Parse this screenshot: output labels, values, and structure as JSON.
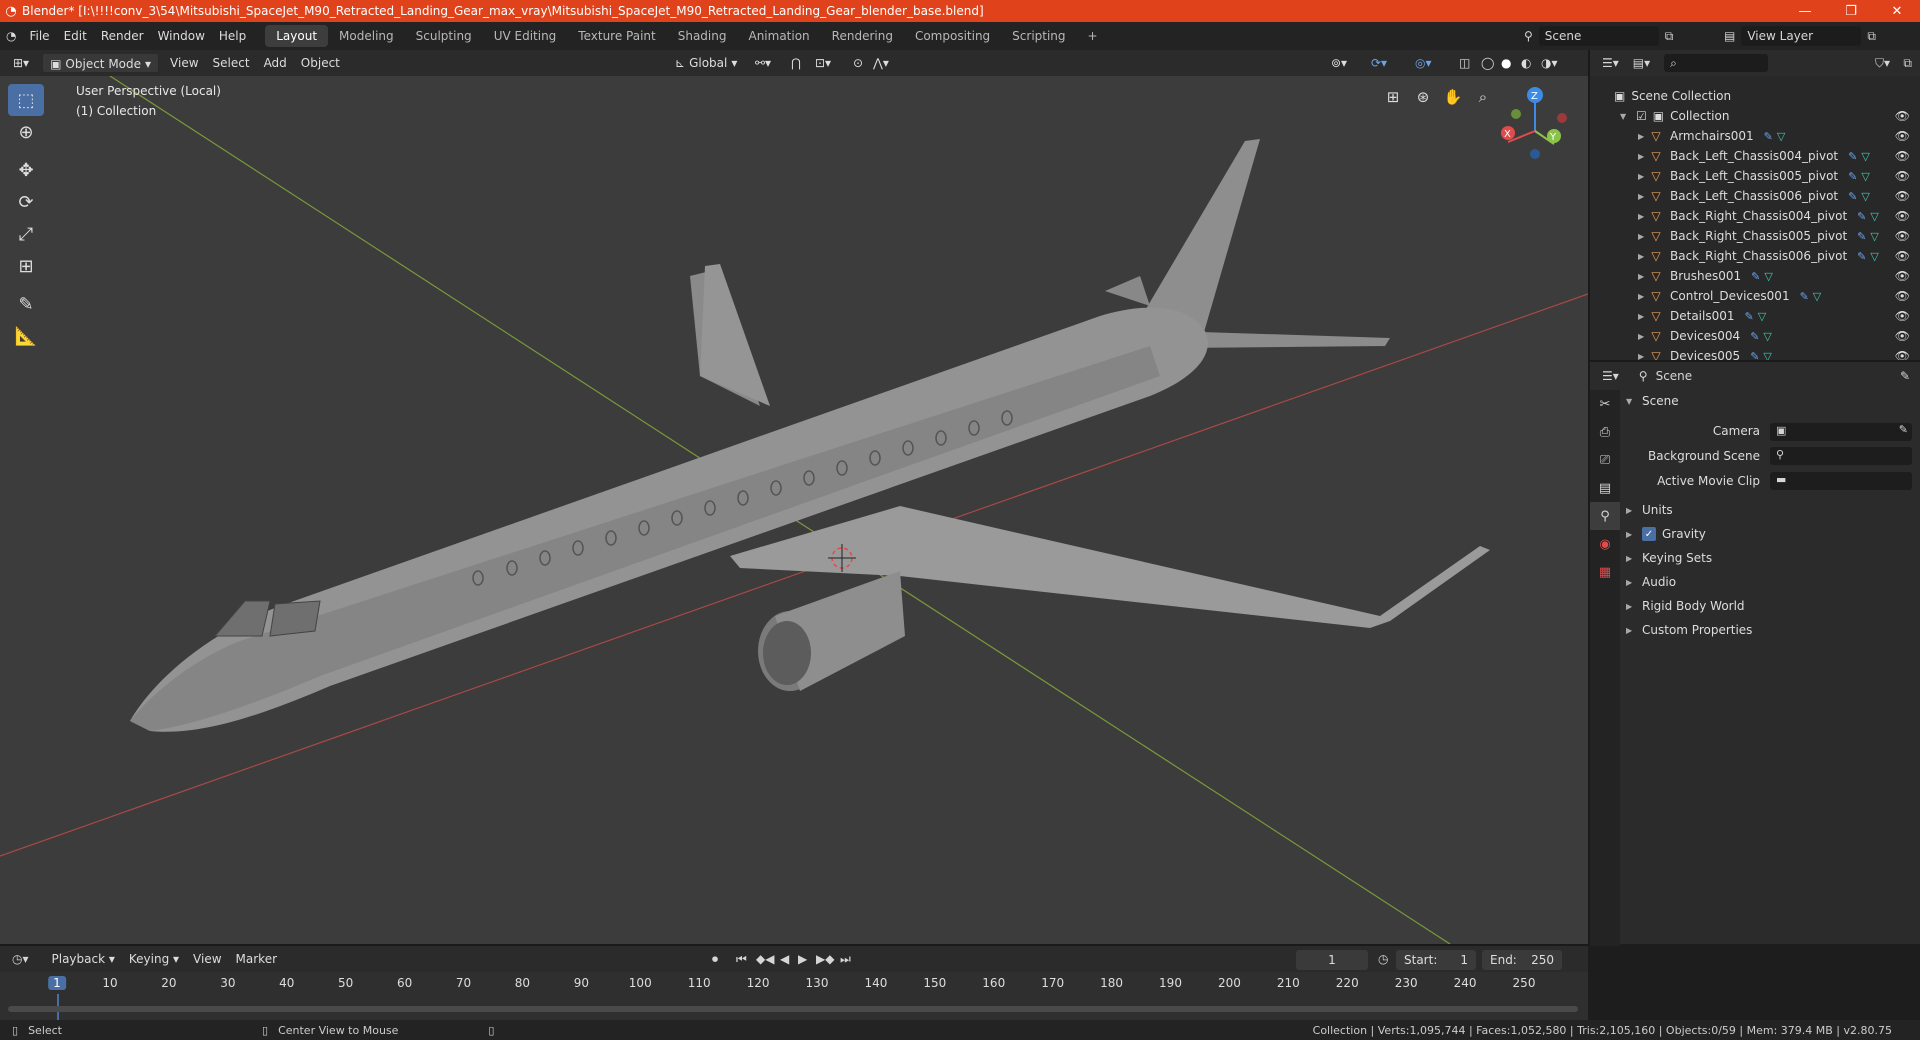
{
  "titlebar": {
    "title": "Blender* [I:\\!!!!conv_3\\54\\Mitsubishi_SpaceJet_M90_Retracted_Landing_Gear_max_vray\\Mitsubishi_SpaceJet_M90_Retracted_Landing_Gear_blender_base.blend]",
    "minimize": "—",
    "maximize": "❐",
    "close": "✕"
  },
  "menu": [
    "File",
    "Edit",
    "Render",
    "Window",
    "Help"
  ],
  "workspaces": [
    "Layout",
    "Modeling",
    "Sculpting",
    "UV Editing",
    "Texture Paint",
    "Shading",
    "Animation",
    "Rendering",
    "Compositing",
    "Scripting"
  ],
  "active_workspace": "Layout",
  "add_workspace": "+",
  "scene_name": "Scene",
  "view_layer": "View Layer",
  "header3d": {
    "mode": "Object Mode",
    "view": "View",
    "select": "Select",
    "add": "Add",
    "object": "Object",
    "orientation": "Global"
  },
  "viewport": {
    "perspective_label": "User Perspective (Local)",
    "collection_label": "(1) Collection",
    "axes": {
      "x": "X",
      "y": "Y",
      "z": "Z"
    }
  },
  "outliner": {
    "root": "Scene Collection",
    "collection": "Collection",
    "items": [
      "Armchairs001",
      "Back_Left_Chassis004_pivot",
      "Back_Left_Chassis005_pivot",
      "Back_Left_Chassis006_pivot",
      "Back_Right_Chassis004_pivot",
      "Back_Right_Chassis005_pivot",
      "Back_Right_Chassis006_pivot",
      "Brushes001",
      "Control_Devices001",
      "Details001",
      "Devices004",
      "Devices005"
    ]
  },
  "properties": {
    "context": "Scene",
    "panel": "Scene",
    "fields": [
      {
        "label": "Camera"
      },
      {
        "label": "Background Scene"
      },
      {
        "label": "Active Movie Clip"
      }
    ],
    "sections": [
      "Units",
      "Gravity",
      "Keying Sets",
      "Audio",
      "Rigid Body World",
      "Custom Properties"
    ],
    "gravity_checked": true
  },
  "timeline": {
    "playback": "Playback",
    "keying": "Keying",
    "view": "View",
    "marker": "Marker",
    "current_frame": "1",
    "start_label": "Start:",
    "start": "1",
    "end_label": "End:",
    "end": "250",
    "ticks": [
      "1",
      "10",
      "20",
      "30",
      "40",
      "50",
      "60",
      "70",
      "80",
      "90",
      "100",
      "110",
      "120",
      "130",
      "140",
      "150",
      "160",
      "170",
      "180",
      "190",
      "200",
      "210",
      "220",
      "230",
      "240",
      "250"
    ]
  },
  "statusbar": {
    "select": "Select",
    "center_view": "Center View to Mouse",
    "stats": "Collection | Verts:1,095,744 | Faces:1,052,580 | Tris:2,105,160 | Objects:0/59 | Mem: 379.4 MB | v2.80.75"
  },
  "colors": {
    "titlebar": "#e0431b",
    "accent": "#4a6fa5",
    "x_axis": "#e04b4b",
    "y_axis": "#8bc34a",
    "z_axis": "#3c8ce7"
  }
}
